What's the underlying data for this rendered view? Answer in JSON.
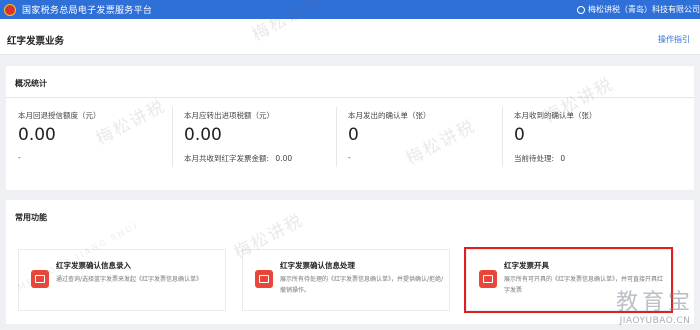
{
  "header": {
    "app_title": "国家税务总局电子发票服务平台",
    "user_name": "梅松讲税（青岛）科技有限公司"
  },
  "page": {
    "title": "红字发票业务",
    "guide_label": "操作指引"
  },
  "overview": {
    "title": "概况统计",
    "stats": [
      {
        "label": "本月回退授信额度（元）",
        "value": "0.00",
        "sub": "-"
      },
      {
        "label": "本月应转出进项税额（元）",
        "value": "0.00",
        "sub_label": "本月共收到红字发票金额:",
        "sub_value": "0.00"
      },
      {
        "label": "本月发出的确认单（张）",
        "value": "0",
        "sub": "-"
      },
      {
        "label": "本月收到的确认单（张）",
        "value": "0",
        "sub_label": "当前待处理:",
        "sub_value": "0"
      }
    ]
  },
  "functions": {
    "title": "常用功能",
    "items": [
      {
        "title": "红字发票确认信息录入",
        "desc": "通过查询/选择蓝字发票来发起《红字发票信息确认单》"
      },
      {
        "title": "红字发票确认信息处理",
        "desc": "展示所有待处理的《红字发票信息确认单》，并提供确认/拒绝/撤销操作。"
      },
      {
        "title": "红字发票开具",
        "desc": "展示所有可开具的《红字发票信息确认单》，并可直接开具红字发票"
      }
    ]
  },
  "watermarks": {
    "text": "梅松讲税",
    "sub": "MEI SONG JIANG SHUI",
    "corner": "教育宝",
    "corner_url": "JIAOYUBAO.CN"
  },
  "colors": {
    "header_bg": "#2f6fd8",
    "accent_red": "#e7463a",
    "highlight_border": "#e02020",
    "link": "#2f6fd8"
  },
  "icons": [
    "national-emblem-icon",
    "user-icon",
    "invoice-entry-icon",
    "invoice-process-icon",
    "invoice-issue-icon"
  ]
}
